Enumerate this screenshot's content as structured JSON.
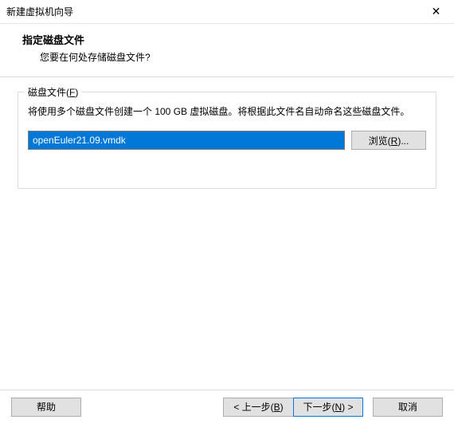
{
  "window": {
    "title": "新建虚拟机向导"
  },
  "header": {
    "title": "指定磁盘文件",
    "description": "您要在何处存储磁盘文件?"
  },
  "group": {
    "label_prefix": "磁盘文件(",
    "label_hotkey": "F",
    "label_suffix": ")",
    "text": "将使用多个磁盘文件创建一个 100 GB 虚拟磁盘。将根据此文件名自动命名这些磁盘文件。",
    "path_value": "openEuler21.09.vmdk",
    "browse_prefix": "浏览(",
    "browse_hotkey": "R",
    "browse_suffix": ")..."
  },
  "footer": {
    "help": "帮助",
    "back_prefix": "< 上一步(",
    "back_hotkey": "B",
    "back_suffix": ")",
    "next_prefix": "下一步(",
    "next_hotkey": "N",
    "next_suffix": ") >",
    "cancel": "取消"
  }
}
